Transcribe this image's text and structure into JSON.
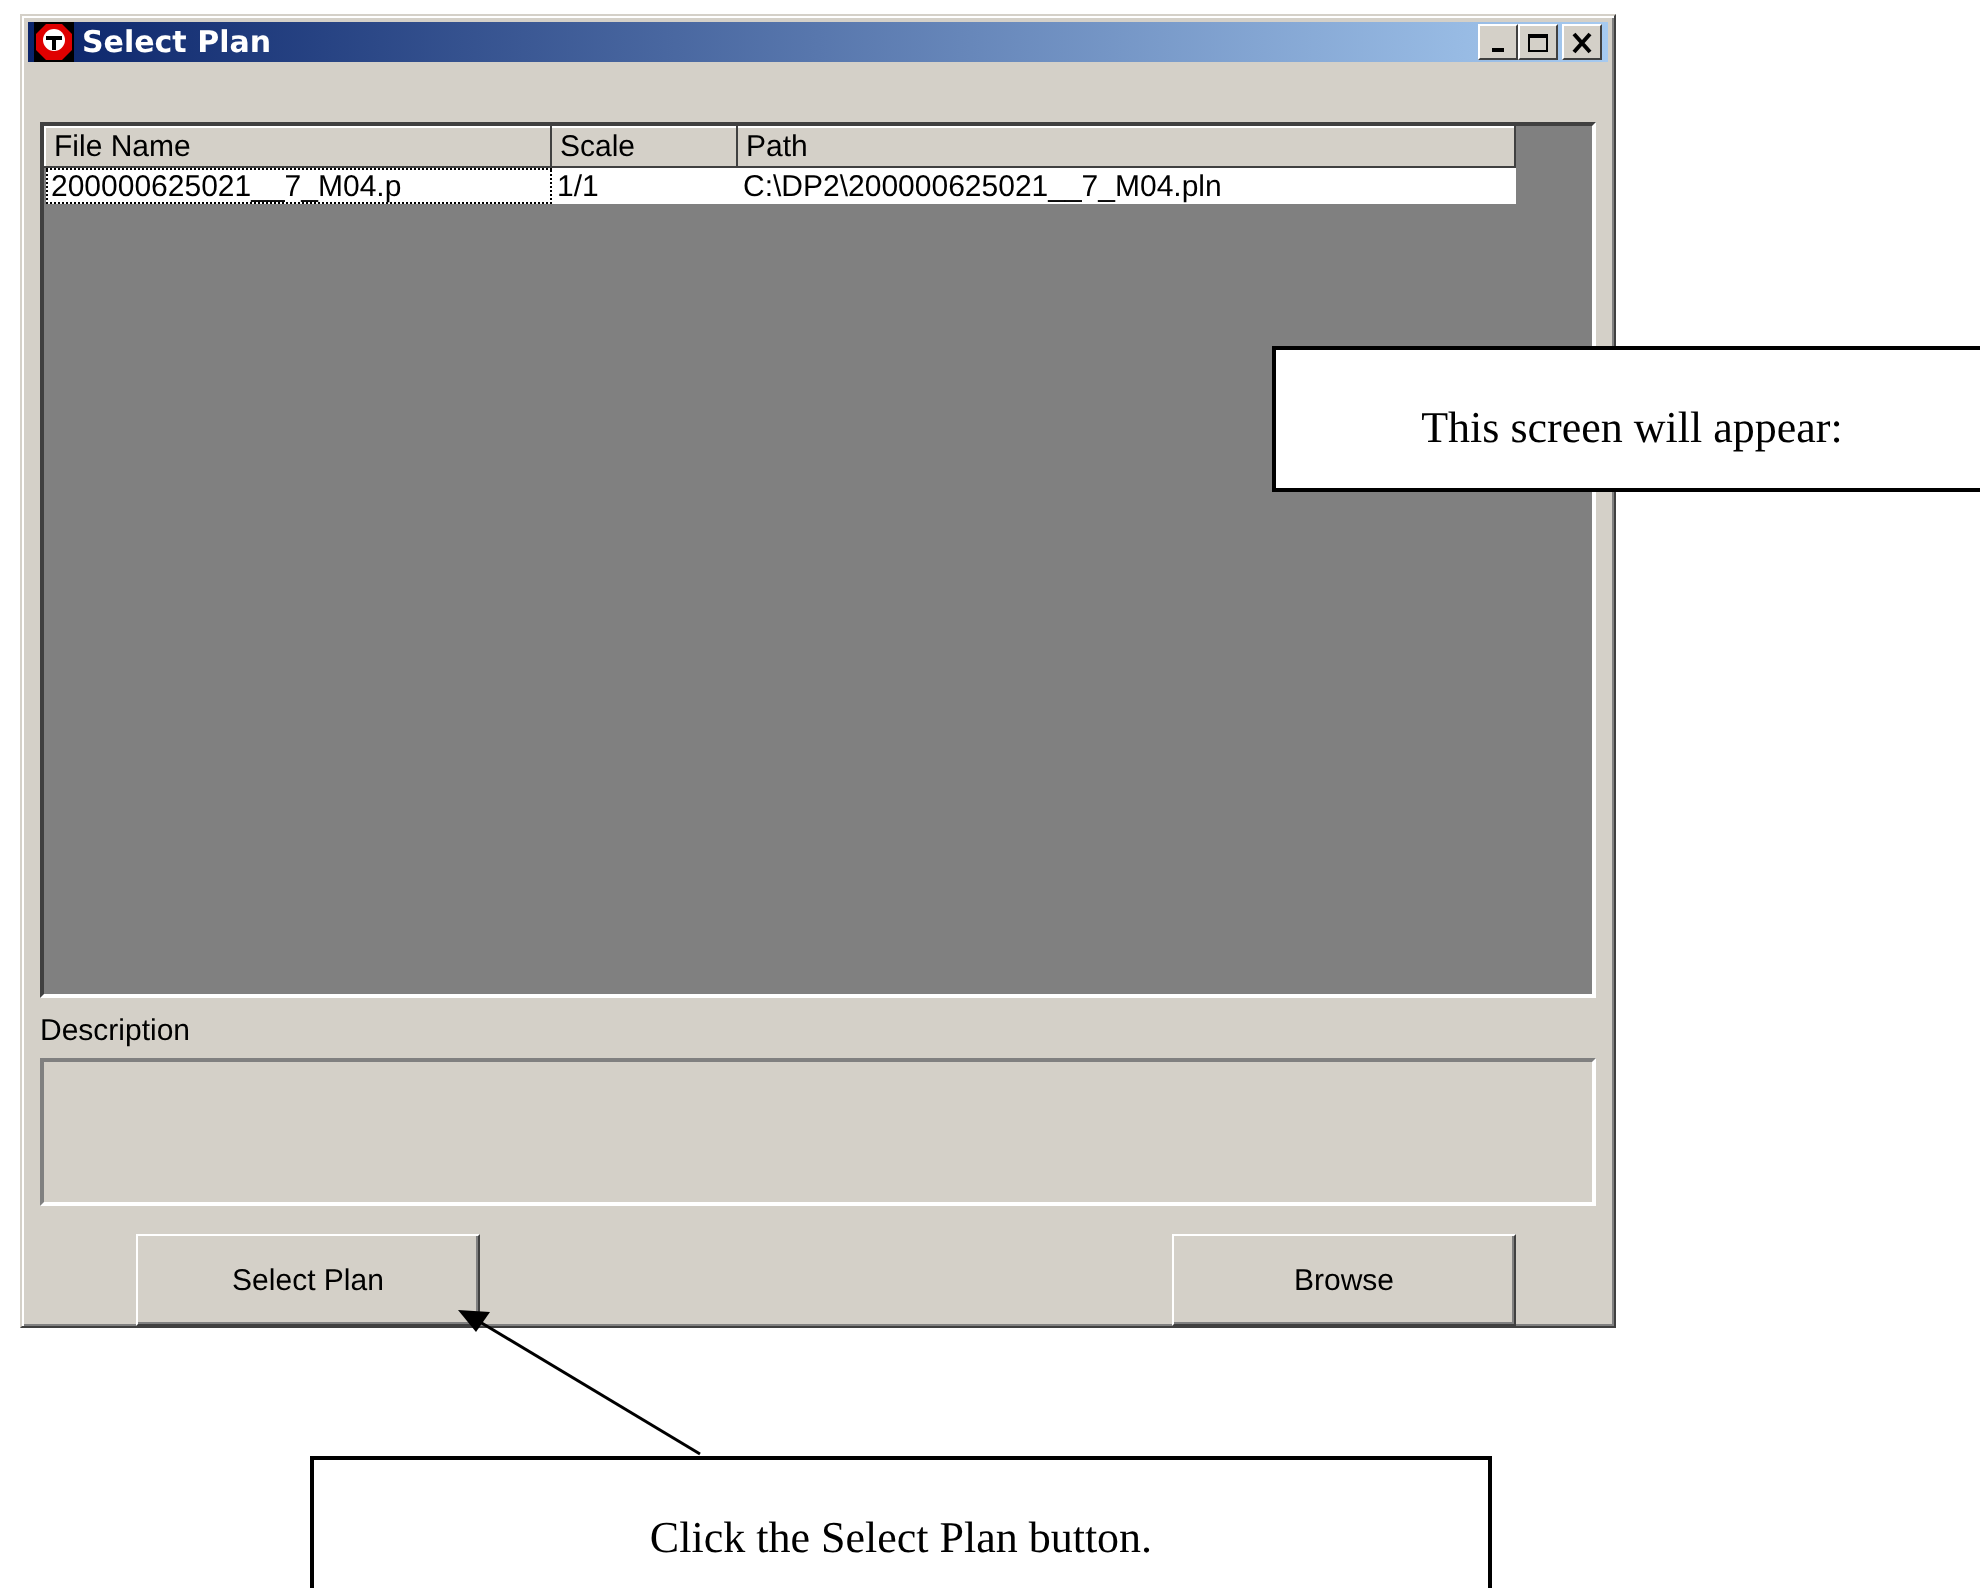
{
  "window": {
    "title": "Select Plan"
  },
  "list": {
    "columns": [
      "File Name",
      "Scale",
      "Path"
    ],
    "rows": [
      {
        "cells": [
          "200000625021__7_M04.p",
          "1/1",
          "C:\\DP2\\200000625021__7_M04.pln"
        ],
        "selected": true
      }
    ]
  },
  "description": {
    "label": "Description"
  },
  "buttons": [
    "Select Plan",
    "Browse"
  ],
  "callouts": [
    {
      "text": "This screen will appear:"
    },
    {
      "text": "Click the Select Plan button."
    }
  ]
}
